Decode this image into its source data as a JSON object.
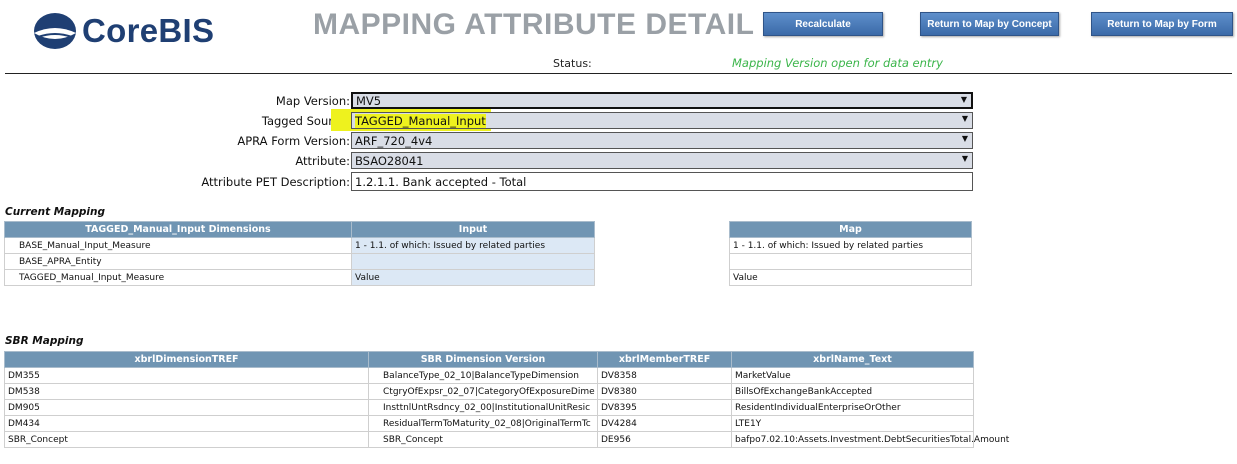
{
  "header": {
    "logo_text": "CoreBIS",
    "title": "MAPPING ATTRIBUTE DETAIL",
    "buttons": {
      "recalculate": "Recalculate",
      "return_concept": "Return to Map by Concept",
      "return_form": "Return to Map by Form"
    },
    "status_label": "Status:",
    "status_value": "Mapping Version open for data entry"
  },
  "form": {
    "map_version_label": "Map Version:",
    "map_version": "MV5",
    "tagged_source_label": "Tagged Source:",
    "tagged_source": "TAGGED_Manual_Input",
    "apra_form_version_label": "APRA Form Version:",
    "apra_form_version": "ARF_720_4v4",
    "attribute_label": "Attribute:",
    "attribute": "BSAO28041",
    "pet_description_label": "Attribute PET Description:",
    "pet_description": "1.2.1.1. Bank accepted - Total"
  },
  "current_mapping": {
    "title": "Current Mapping",
    "col_dimensions": "TAGGED_Manual_Input Dimensions",
    "col_input": "Input",
    "col_map": "Map",
    "rows": [
      {
        "dimension": "BASE_Manual_Input_Measure",
        "input": "1 - 1.1. of which: Issued by related parties",
        "map": "1 - 1.1. of which: Issued by related parties"
      },
      {
        "dimension": "BASE_APRA_Entity",
        "input": "",
        "map": ""
      },
      {
        "dimension": "TAGGED_Manual_Input_Measure",
        "input": "Value",
        "map": "Value"
      }
    ]
  },
  "sbr_mapping": {
    "title": "SBR Mapping",
    "col_dimension_tref": "xbrlDimensionTREF",
    "col_sbr_version": "SBR Dimension Version",
    "col_member_tref": "xbrlMemberTREF",
    "col_name_text": "xbrlName_Text",
    "rows": [
      {
        "dim": "DM355",
        "version": "BalanceType_02_10|BalanceTypeDimension",
        "member": "DV8358",
        "name": "MarketValue"
      },
      {
        "dim": "DM538",
        "version": "CtgryOfExpsr_02_07|CategoryOfExposureDime",
        "member": "DV8380",
        "name": "BillsOfExchangeBankAccepted"
      },
      {
        "dim": "DM905",
        "version": "InsttnlUntRsdncy_02_00|InstitutionalUnitResic",
        "member": "DV8395",
        "name": "ResidentIndividualEnterpriseOrOther"
      },
      {
        "dim": "DM434",
        "version": "ResidualTermToMaturity_02_08|OriginalTermTc",
        "member": "DV4284",
        "name": "LTE1Y"
      },
      {
        "dim": "SBR_Concept",
        "version": "SBR_Concept",
        "member": "DE956",
        "name": "bafpo7.02.10:Assets.Investment.DebtSecuritiesTotal.Amount"
      }
    ]
  }
}
